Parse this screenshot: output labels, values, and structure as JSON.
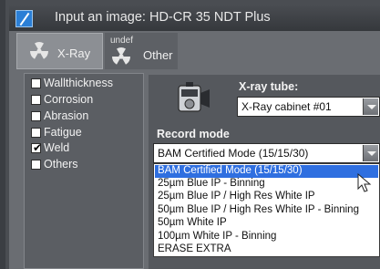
{
  "window": {
    "title": "Input an image: HD-CR 35 NDT Plus"
  },
  "tabs": [
    {
      "label": "X-Ray",
      "badge": "",
      "icon": "radiation-icon",
      "active": true
    },
    {
      "label": "Other",
      "badge": "undef",
      "icon": "radiation-icon",
      "active": false
    }
  ],
  "checkboxes": [
    {
      "label": "Wallthickness",
      "checked": false
    },
    {
      "label": "Corrosion",
      "checked": false
    },
    {
      "label": "Abrasion",
      "checked": false
    },
    {
      "label": "Fatigue",
      "checked": false
    },
    {
      "label": "Weld",
      "checked": true
    },
    {
      "label": "Others",
      "checked": false
    }
  ],
  "xray_tube": {
    "label": "X-ray tube:",
    "value": "X-Ray cabinet #01"
  },
  "record_mode": {
    "label": "Record mode",
    "value": "BAM Certified Mode (15/15/30)",
    "options": [
      "BAM Certified Mode (15/15/30)",
      "25µm Blue IP - Binning",
      "25µm Blue IP / High Res White IP",
      "50µm Blue IP / High Res White IP - Binning",
      "50µm White IP",
      "100µm White IP - Binning",
      "ERASE EXTRA"
    ],
    "highlighted_index": 0
  },
  "colors": {
    "selection": "#2f6fe0",
    "app_icon": "#2b7fd6"
  }
}
